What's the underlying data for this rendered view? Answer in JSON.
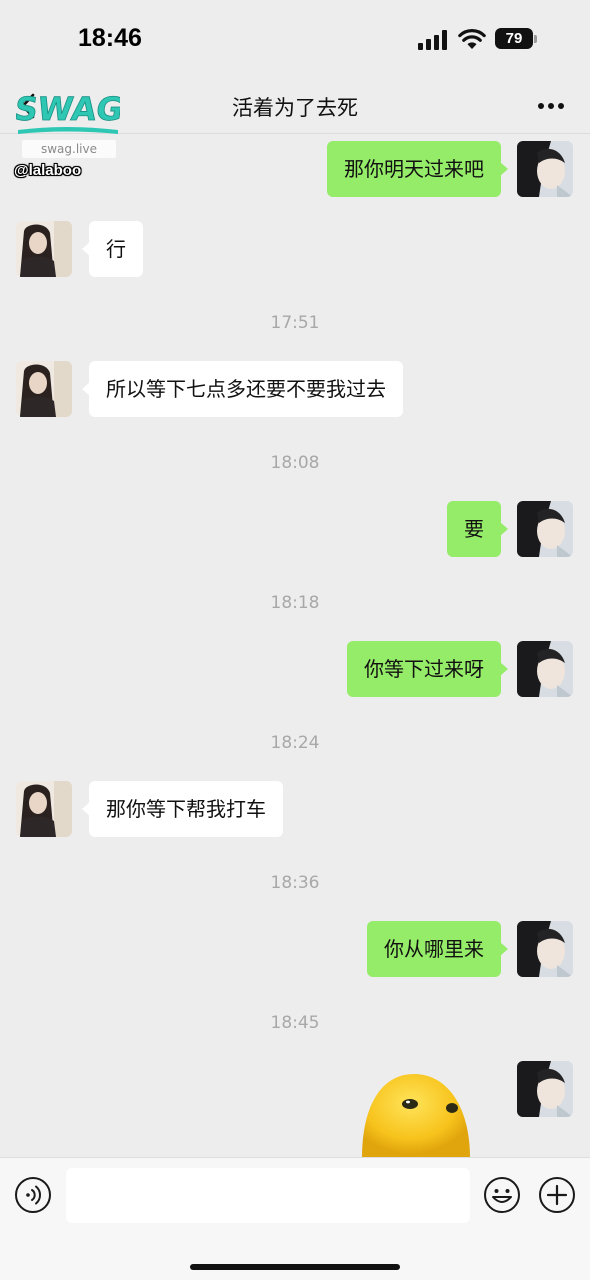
{
  "status_bar": {
    "time": "18:46",
    "battery": "79"
  },
  "nav": {
    "title": "活着为了去死"
  },
  "watermark": {
    "logo_text": "SWAG",
    "url": "swag.live",
    "handle": "@lalaboo"
  },
  "messages": [
    {
      "type": "message",
      "side": "right",
      "text": "那你明天过来吧"
    },
    {
      "type": "message",
      "side": "left",
      "text": "行"
    },
    {
      "type": "timestamp",
      "text": "17:51"
    },
    {
      "type": "message",
      "side": "left",
      "text": "所以等下七点多还要不要我过去"
    },
    {
      "type": "timestamp",
      "text": "18:08"
    },
    {
      "type": "message",
      "side": "right",
      "text": "要"
    },
    {
      "type": "timestamp",
      "text": "18:18"
    },
    {
      "type": "message",
      "side": "right",
      "text": "你等下过来呀"
    },
    {
      "type": "timestamp",
      "text": "18:24"
    },
    {
      "type": "message",
      "side": "left",
      "text": "那你等下帮我打车"
    },
    {
      "type": "timestamp",
      "text": "18:36"
    },
    {
      "type": "message",
      "side": "right",
      "text": "你从哪里来"
    },
    {
      "type": "timestamp",
      "text": "18:45"
    },
    {
      "type": "sticker",
      "side": "right",
      "icon": "yellow-blob-sticker"
    }
  ],
  "input_bar": {
    "input_value": "",
    "placeholder": ""
  },
  "colors": {
    "background": "#ededed",
    "outgoing_bubble": "#95ec69",
    "incoming_bubble": "#ffffff",
    "timestamp": "#a8a8a8"
  }
}
